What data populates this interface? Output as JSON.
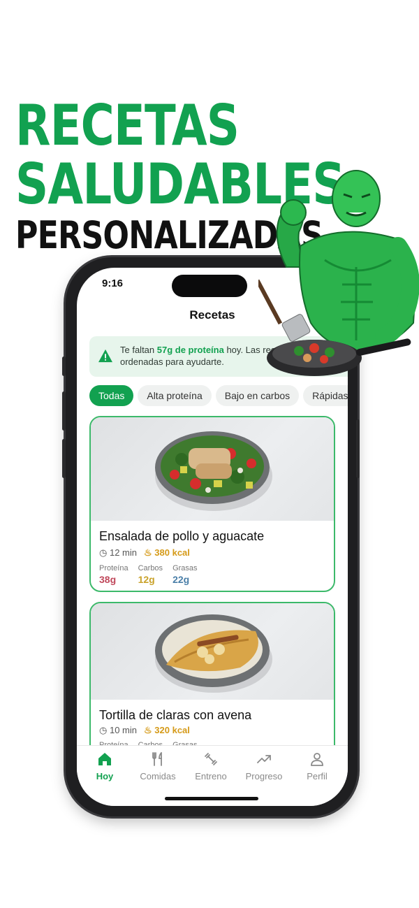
{
  "headline": {
    "line1": "RECETAS",
    "line2": "SALUDABLES",
    "line3": "PERSONALIZADAS"
  },
  "status": {
    "time": "9:16"
  },
  "screen": {
    "title": "Recetas"
  },
  "alert": {
    "icon": "warning-icon",
    "prefix": "Te faltan ",
    "highlight": "57g de proteína",
    "suffix": " hoy. Las recetas están ordenadas para ayudarte."
  },
  "filters": [
    {
      "label": "Todas",
      "active": true
    },
    {
      "label": "Alta proteína",
      "active": false
    },
    {
      "label": "Bajo en carbos",
      "active": false
    },
    {
      "label": "Rápidas",
      "active": false
    }
  ],
  "recipes": [
    {
      "title": "Ensalada de pollo y aguacate",
      "time": "12 min",
      "kcal": "380 kcal",
      "macros": [
        {
          "label": "Proteína",
          "value": "38g"
        },
        {
          "label": "Carbos",
          "value": "12g"
        },
        {
          "label": "Grasas",
          "value": "22g"
        }
      ]
    },
    {
      "title": "Tortilla de claras con avena",
      "time": "10 min",
      "kcal": "320 kcal",
      "macros": [
        {
          "label": "Proteína",
          "value": ""
        },
        {
          "label": "Carbos",
          "value": ""
        },
        {
          "label": "Grasas",
          "value": ""
        }
      ]
    }
  ],
  "tabs": [
    {
      "label": "Hoy",
      "icon": "home-icon",
      "active": true
    },
    {
      "label": "Comidas",
      "icon": "utensils-icon",
      "active": false
    },
    {
      "label": "Entreno",
      "icon": "dumbbell-icon",
      "active": false
    },
    {
      "label": "Progreso",
      "icon": "trend-icon",
      "active": false
    },
    {
      "label": "Perfil",
      "icon": "user-icon",
      "active": false
    }
  ],
  "colors": {
    "brand_green": "#12a150",
    "kcal_gold": "#d59a18",
    "protein": "#c0485b",
    "carbs": "#c9a22a",
    "fats": "#4a7fa8"
  }
}
